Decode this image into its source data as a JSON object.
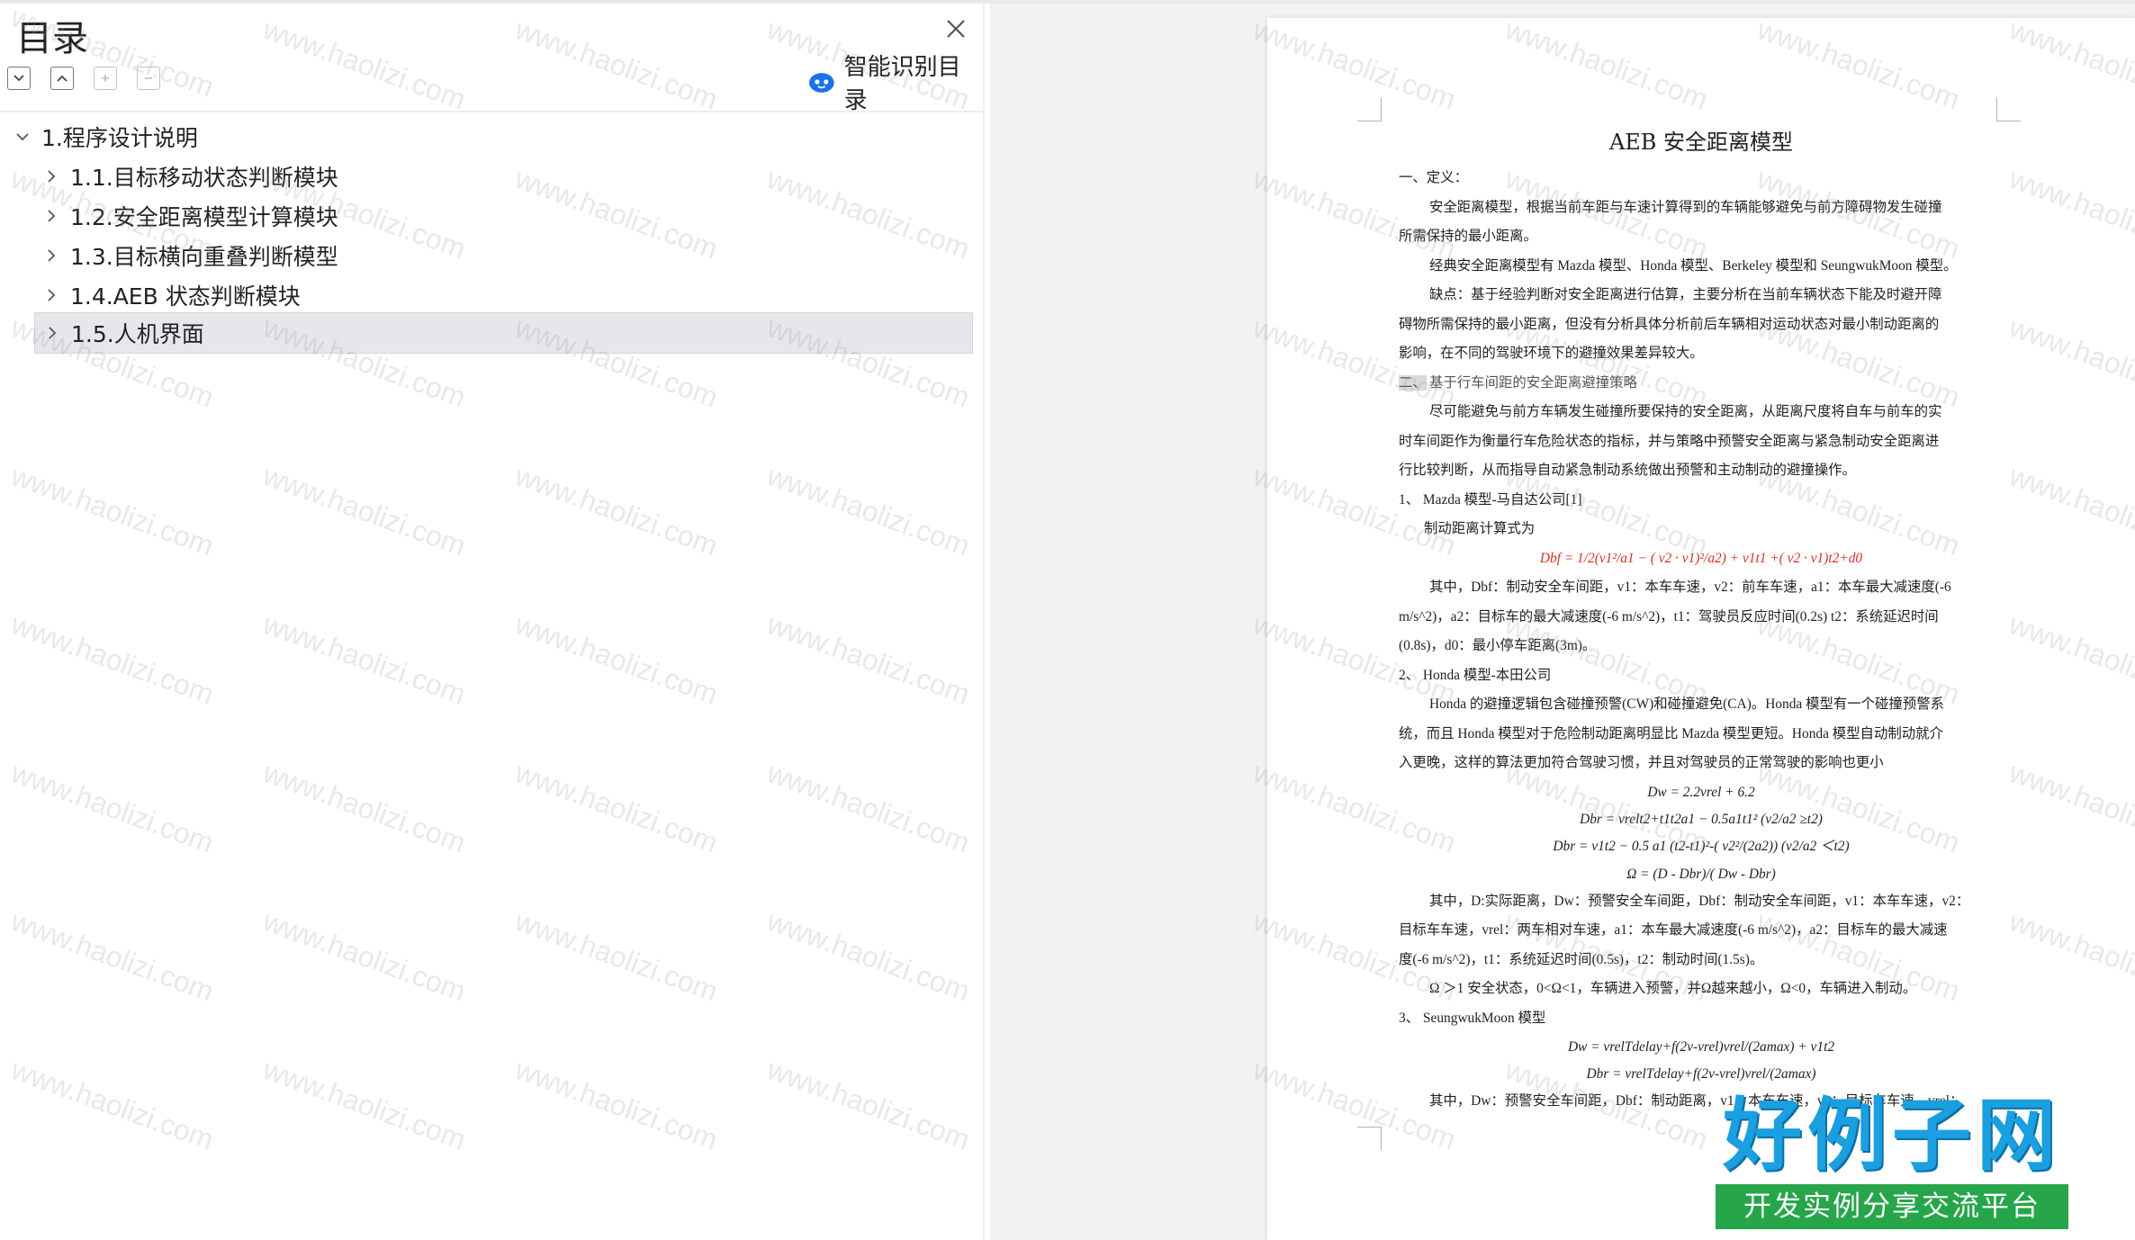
{
  "toc": {
    "title": "目录",
    "smart_button_label": "智能识别目录",
    "items": [
      {
        "label": "1.程序设计说明",
        "expanded": true
      },
      {
        "label": "1.1.目标移动状态判断模块"
      },
      {
        "label": "1.2.安全距离模型计算模块"
      },
      {
        "label": "1.3.目标横向重叠判断模型"
      },
      {
        "label": "1.4.AEB 状态判断模块"
      },
      {
        "label": "1.5.人机界面",
        "selected": true
      }
    ]
  },
  "document": {
    "title": "AEB 安全距离模型",
    "lines": [
      "一、定义：",
      "安全距离模型，根据当前车距与车速计算得到的车辆能够避免与前方障碍物发生碰撞",
      "所需保持的最小距离。",
      "经典安全距离模型有 Mazda 模型、Honda 模型、Berkeley 模型和 SeungwukMoon 模型。",
      "缺点：基于经验判断对安全距离进行估算，主要分析在当前车辆状态下能及时避开障",
      "碍物所需保持的最小距离，但没有分析具体分析前后车辆相对运动状态对最小制动距离的",
      "影响，在不同的驾驶环境下的避撞效果差异较大。",
      "二、",
      "基于行车间距的安全距离避撞策略",
      "尽可能避免与前方车辆发生碰撞所要保持的安全距离，从距离尺度将自车与前车的实",
      "时车间距作为衡量行车危险状态的指标，并与策略中预警安全距离与紧急制动安全距离进",
      "行比较判断，从而指导自动紧急制动系统做出预警和主动制动的避撞操作。",
      "1、 Mazda 模型-马自达公司[1]",
      "制动距离计算式为",
      "Dbf = 1/2(v1²/a1 − ( v2 · v1)²/a2) + v1t1 +( v2 · v1)t2+d0",
      "其中，Dbf：制动安全车间距，v1：本车车速，v2：前车车速，a1：本车最大减速度(-6",
      "m/s^2)，a2：目标车的最大减速度(-6 m/s^2)，t1：驾驶员反应时间(0.2s) t2：系统延迟时间",
      "(0.8s)，d0：最小停车距离(3m)。",
      "2、 Honda 模型-本田公司",
      "Honda 的避撞逻辑包含碰撞预警(CW)和碰撞避免(CA)。Honda 模型有一个碰撞预警系",
      "统，而且 Honda 模型对于危险制动距离明显比 Mazda 模型更短。Honda 模型自动制动就介",
      "入更晚，这样的算法更加符合驾驶习惯，并且对驾驶员的正常驾驶的影响也更小",
      "Dw = 2.2vrel + 6.2",
      "Dbr = vrelt2+t1t2a1 − 0.5a1t1²    (v2/a2 ≥t2)",
      "Dbr = v1t2 − 0.5 a1 (t2-t1)²-( v2²/(2a2))    (v2/a2 ＜t2)",
      "Ω = (D - Dbr)/( Dw - Dbr)",
      "其中，D:实际距离，Dw：预警安全车间距，Dbf：制动安全车间距，v1：本车车速，v2：",
      "目标车车速，vrel：两车相对车速，a1：本车最大减速度(-6 m/s^2)，a2：目标车的最大减速",
      "度(-6 m/s^2)，t1：系统延迟时间(0.5s)，t2：制动时间(1.5s)。",
      "Ω ＞1 安全状态，0<Ω<1，车辆进入预警，并Ω越来越小，Ω<0，车辆进入制动。",
      "3、 SeungwukMoon 模型",
      "Dw = vrelTdelay+f(2v-vrel)vrel/(2amax) + v1t2",
      "Dbr = vrelTdelay+f(2v-vrel)vrel/(2amax)",
      "其中，Dw：预警安全车间距，Dbf：制动距离，v1：本车车速，v2：目标车车速，vrel："
    ]
  },
  "watermark": {
    "text": "www.haolizi.com"
  },
  "logo": {
    "main": "好例子网",
    "sub": "开发实例分享交流平台"
  },
  "icons": {
    "close": "close-icon",
    "expand_all": "chevron-down-box-icon",
    "collapse_all": "chevron-up-box-icon",
    "add_heading": "add-box-icon",
    "remove_heading": "minus-box-icon",
    "smart": "smart-cloud-icon",
    "tree_expanded": "chevron-down-icon",
    "tree_collapsed": "chevron-right-icon"
  },
  "colors": {
    "selected_row": "#e5e7eb",
    "smart_icon": "#1a73e8",
    "red_formula": "#d93025",
    "logo_blue": "#1a9fe0",
    "logo_green": "#27a54a"
  }
}
